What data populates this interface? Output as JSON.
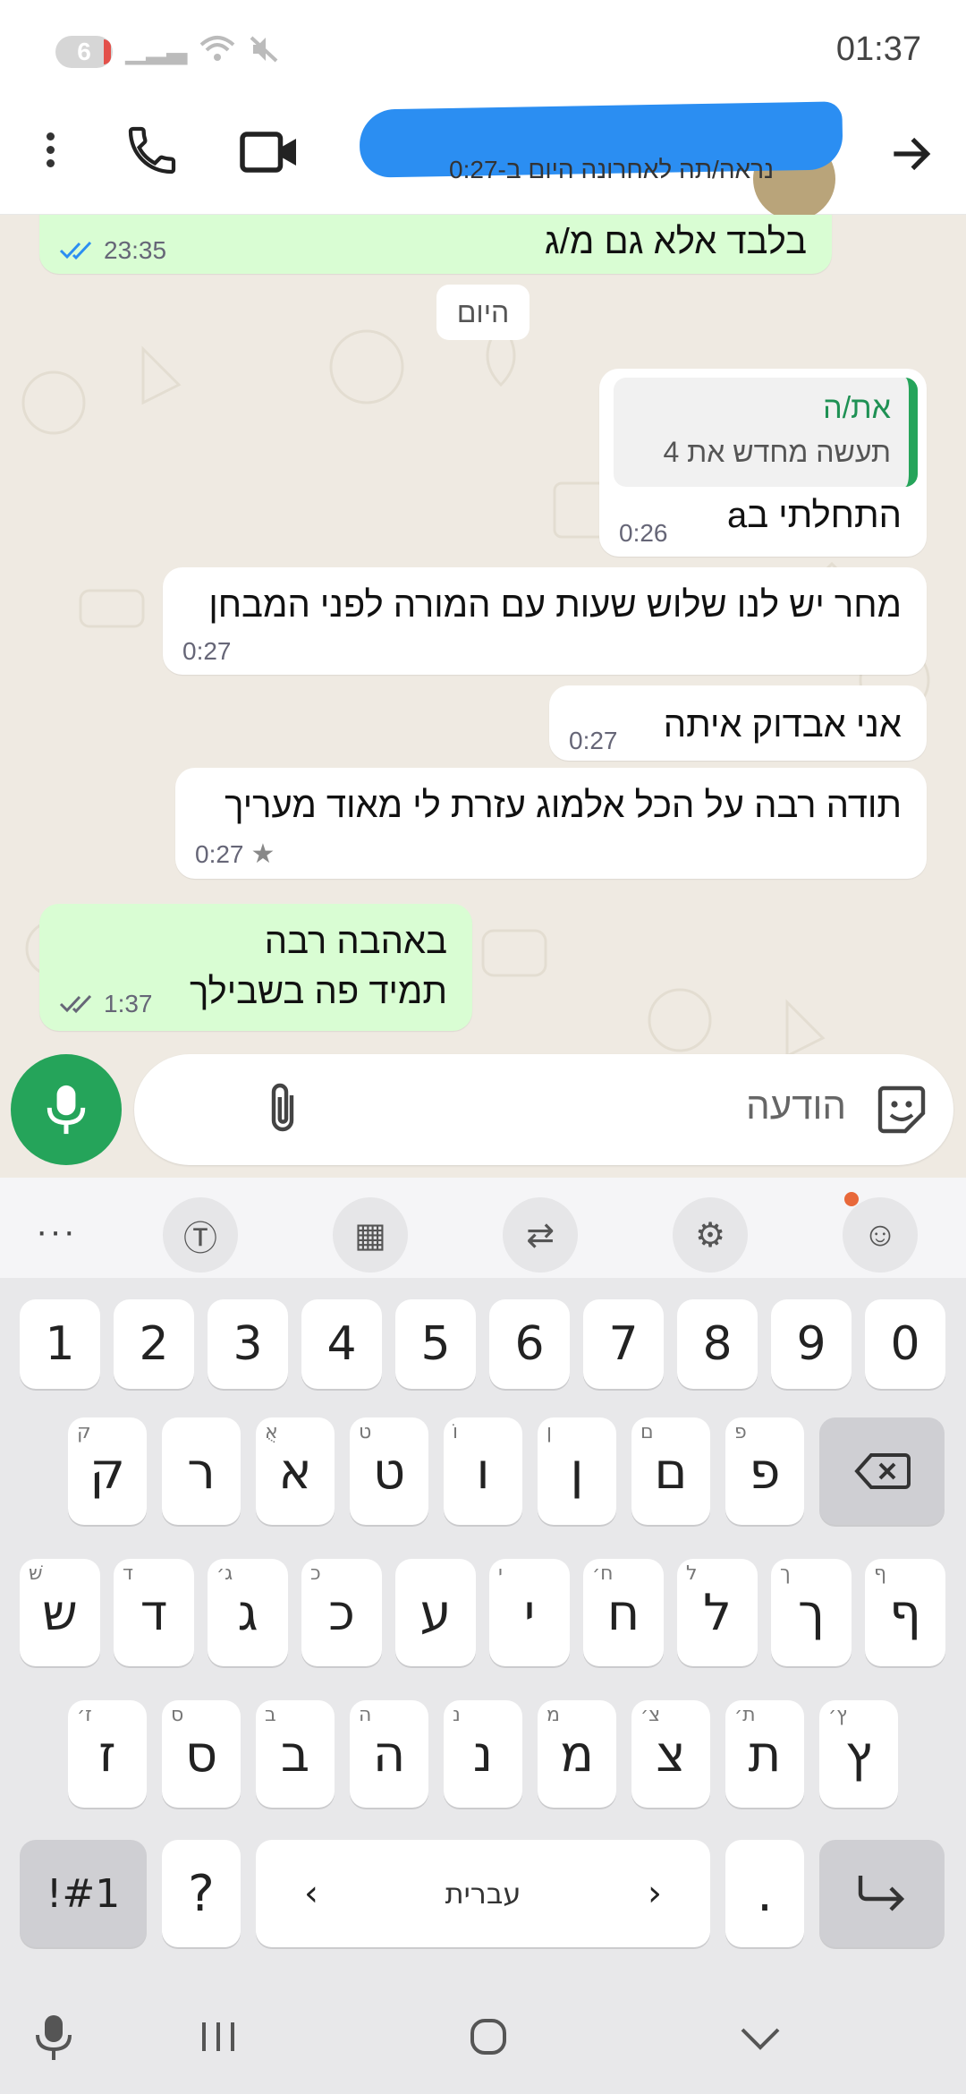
{
  "status_bar": {
    "notification_count": "6",
    "time": "01:37"
  },
  "header": {
    "last_seen": "נראה/תה לאחרונה היום ב-0:27",
    "icons": [
      "more-vert-icon",
      "phone-icon",
      "video-call-icon",
      "back-arrow-icon"
    ]
  },
  "chat": {
    "prev_message": {
      "text": "בלבד אלא גם מ/ג",
      "time": "23:35"
    },
    "day_chip": "היום",
    "messages": [
      {
        "direction": "in",
        "quote_name": "את/ה",
        "quote_text": "תעשה מחדש את 4",
        "text": "התחלתי בa",
        "time": "0:26"
      },
      {
        "direction": "in",
        "text": "מחר יש לנו שלוש שעות עם המורה לפני המבחן",
        "time": "0:27"
      },
      {
        "direction": "in",
        "text": "אני אבדוק איתה",
        "time": "0:27"
      },
      {
        "direction": "in",
        "text": "תודה רבה על הכל אלמוג עזרת לי מאוד מעריך",
        "time": "0:27",
        "starred": true
      },
      {
        "direction": "out",
        "line1": "באהבה רבה",
        "line2": "תמיד פה בשבילך",
        "time": "1:37"
      }
    ]
  },
  "input": {
    "placeholder": "הודעה"
  },
  "keyboard": {
    "number_row": [
      "1",
      "2",
      "3",
      "4",
      "5",
      "6",
      "7",
      "8",
      "9",
      "0"
    ],
    "row1": [
      {
        "key": "ק",
        "hint": "ק"
      },
      {
        "key": "ר",
        "hint": ""
      },
      {
        "key": "א",
        "hint": "אֻ"
      },
      {
        "key": "ט",
        "hint": "ט"
      },
      {
        "key": "ו",
        "hint": "וֹ"
      },
      {
        "key": "ן",
        "hint": "ן"
      },
      {
        "key": "ם",
        "hint": "ם"
      },
      {
        "key": "פ",
        "hint": "פ"
      }
    ],
    "row2": [
      {
        "key": "ש",
        "hint": "שׁ"
      },
      {
        "key": "ד",
        "hint": "ד"
      },
      {
        "key": "ג",
        "hint": "ג׳"
      },
      {
        "key": "כ",
        "hint": "כ"
      },
      {
        "key": "ע",
        "hint": ""
      },
      {
        "key": "י",
        "hint": "י"
      },
      {
        "key": "ח",
        "hint": "ח׳"
      },
      {
        "key": "ל",
        "hint": "ל"
      },
      {
        "key": "ך",
        "hint": "ך"
      },
      {
        "key": "ף",
        "hint": "ף"
      }
    ],
    "row3": [
      {
        "key": "ז",
        "hint": "ז׳"
      },
      {
        "key": "ס",
        "hint": "ס"
      },
      {
        "key": "ב",
        "hint": "ב"
      },
      {
        "key": "ה",
        "hint": "ה"
      },
      {
        "key": "נ",
        "hint": "נ"
      },
      {
        "key": "מ",
        "hint": "מ"
      },
      {
        "key": "צ",
        "hint": "צ׳"
      },
      {
        "key": "ת",
        "hint": "ת׳"
      },
      {
        "key": "ץ",
        "hint": "ץ׳"
      }
    ],
    "symbols_key": "!#1",
    "question_key": "?",
    "space_label": "עברית",
    "period_key": "."
  }
}
